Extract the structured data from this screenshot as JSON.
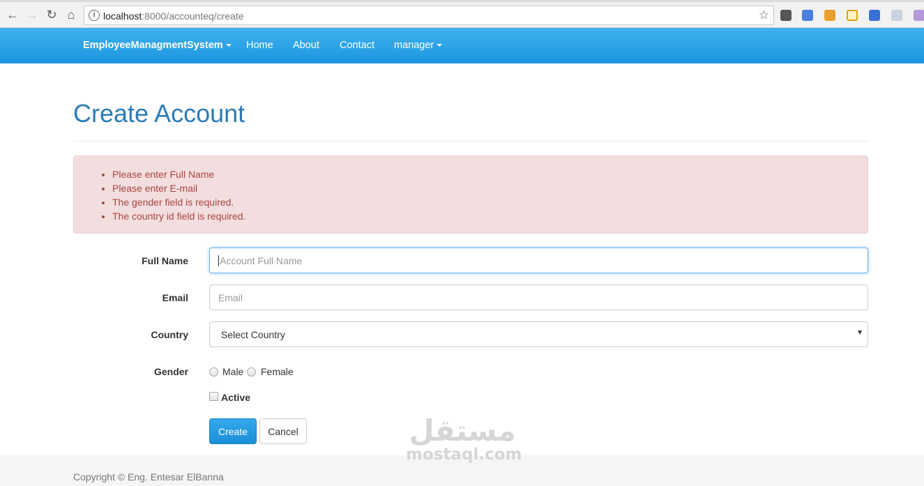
{
  "browser": {
    "url_host": "localhost",
    "url_path": ":8000/accounteq/create",
    "back_icon": "arrow-left-icon",
    "forward_icon": "arrow-right-icon",
    "reload_icon": "reload-icon",
    "home_icon": "home-icon",
    "bookmark_icon": "star-icon"
  },
  "navbar": {
    "brand": "EmployeeManagmentSystem",
    "links": [
      "Home",
      "About",
      "Contact"
    ],
    "user_menu": "manager",
    "color": "#2aa3e8"
  },
  "page": {
    "title": "Create Account"
  },
  "errors": [
    "Please enter Full Name",
    "Please enter E-mail",
    "The gender field is required.",
    "The country id field is required."
  ],
  "form": {
    "full_name_label": "Full Name",
    "full_name_placeholder": "Account Full Name",
    "email_label": "Email",
    "email_placeholder": "Email",
    "country_label": "Country",
    "country_selected": "Select Country",
    "gender_label": "Gender",
    "gender_options": [
      "Male",
      "Female"
    ],
    "active_label": "Active",
    "create_button": "Create",
    "cancel_button": "Cancel"
  },
  "footer": {
    "copyright": "Copyright © Eng. Entesar ElBanna"
  },
  "watermark": {
    "arabic": "مستقل",
    "latin": "mostaql.com"
  }
}
